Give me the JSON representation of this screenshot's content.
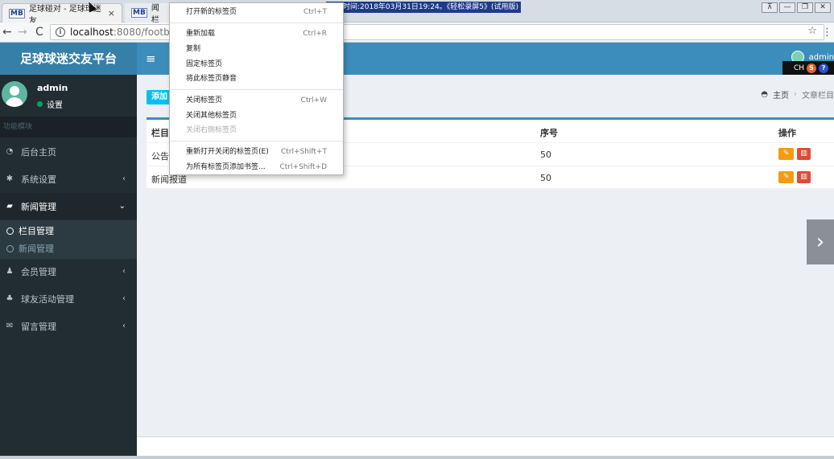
{
  "browser": {
    "tabs": [
      {
        "favicon": "MB",
        "title": "足球碰对 - 足球球迷友",
        "close": "×"
      },
      {
        "favicon": "MB",
        "title": "新闻栏目"
      }
    ],
    "recording_banner": "制作时间:2018年03月31日19:24。《轻松录屏5》(试用版)",
    "url_host": "localhost",
    "url_path": ":8080/footballs",
    "back": "←",
    "forward": "→",
    "reload": "C",
    "star": "☆",
    "menu": "⋮",
    "win_controls": [
      "⊼",
      "—",
      "❐",
      "✕"
    ]
  },
  "context_menu": {
    "items": [
      {
        "label": "打开新的标签页",
        "shortcut": "Ctrl+T"
      },
      {
        "label": "重新加载",
        "shortcut": "Ctrl+R"
      },
      {
        "label": "复制",
        "shortcut": ""
      },
      {
        "label": "固定标签页",
        "shortcut": ""
      },
      {
        "label": "将此标签页静音",
        "shortcut": ""
      },
      {
        "label": "关闭标签页",
        "shortcut": "Ctrl+W"
      },
      {
        "label": "关闭其他标签页",
        "shortcut": ""
      },
      {
        "label": "关闭右侧标签页",
        "shortcut": ""
      },
      {
        "label": "重新打开关闭的标签页(E)",
        "shortcut": "Ctrl+Shift+T"
      },
      {
        "label": "为所有标签页添加书签...",
        "shortcut": "Ctrl+Shift+D"
      }
    ]
  },
  "header": {
    "logo": "足球球迷交友平台",
    "toggle": "≡",
    "user": "admin"
  },
  "overlay_toolbar": {
    "cn": "CH",
    "s": "S",
    "q": "?"
  },
  "sidebar": {
    "user_name": "admin",
    "user_status": "设置",
    "section_label": "功能模块",
    "items": [
      {
        "label": "后台主页",
        "icon": "◔"
      },
      {
        "label": "系统设置",
        "icon": "✱",
        "chevron": "‹"
      },
      {
        "label": "新闻管理",
        "icon": "▰",
        "chevron": "⌄"
      },
      {
        "label": "会员管理",
        "icon": "♟",
        "chevron": "‹"
      },
      {
        "label": "球友活动管理",
        "icon": "♣",
        "chevron": "‹"
      },
      {
        "label": "留言管理",
        "icon": "✉",
        "chevron": "‹"
      }
    ],
    "submenu": [
      {
        "label": "栏目管理"
      },
      {
        "label": "新闻管理"
      }
    ]
  },
  "content": {
    "add_button": "添加",
    "breadcrumb": {
      "home": "主页",
      "sep": "›",
      "current": "文章栏目"
    },
    "table": {
      "headers": [
        "栏目",
        "序号",
        "操作"
      ],
      "rows": [
        {
          "name": "公告",
          "order": "50"
        },
        {
          "name": "新闻报道",
          "order": "50"
        }
      ]
    }
  },
  "next_arrow": "›"
}
